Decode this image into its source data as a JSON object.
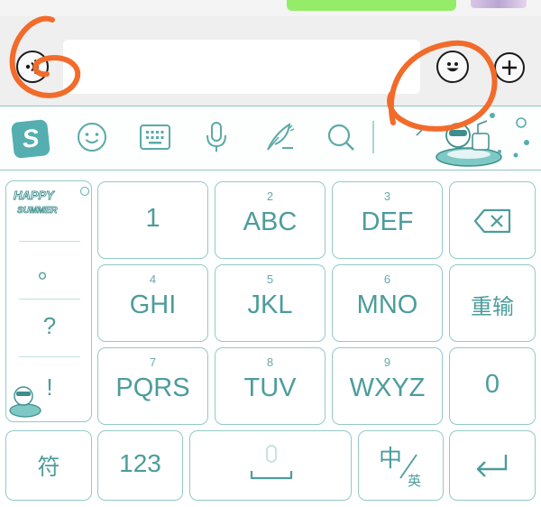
{
  "chat_bar": {
    "voice_icon": "voice-wave-icon",
    "emoji_icon": "smiley-icon",
    "more_icon": "plus-circle-icon"
  },
  "ime_toolbar": {
    "tools": [
      "sogou-logo-icon",
      "smiley-icon",
      "keyboard-icon",
      "microphone-icon",
      "feather-pen-icon",
      "search-icon"
    ],
    "logo_letter": "S",
    "sticker_text": "HAPPY SUMMER"
  },
  "keyboard": {
    "punct_keys": [
      "。",
      "?",
      "!"
    ],
    "keys": {
      "k1": {
        "main": "1",
        "num": ""
      },
      "k2": {
        "main": "ABC",
        "num": "2"
      },
      "k3": {
        "main": "DEF",
        "num": "3"
      },
      "k4": {
        "main": "GHI",
        "num": "4"
      },
      "k5": {
        "main": "JKL",
        "num": "5"
      },
      "k6": {
        "main": "MNO",
        "num": "6"
      },
      "k7": {
        "main": "PQRS",
        "num": "7"
      },
      "k8": {
        "main": "TUV",
        "num": "8"
      },
      "k9": {
        "main": "WXYZ",
        "num": "9"
      },
      "k0": {
        "main": "0",
        "num": ""
      }
    },
    "reinput_label": "重输",
    "symbol_label": "符",
    "numeric_label": "123",
    "lang_main": "中",
    "lang_sub": "英",
    "backspace_icon": "backspace-icon",
    "enter_icon": "enter-icon",
    "space_icon": "microphone-icon"
  },
  "colors": {
    "key_border": "#93c9c7",
    "key_text": "#4d9c9c",
    "annotation": "#f26b2a",
    "send_bubble": "#95ec69"
  }
}
